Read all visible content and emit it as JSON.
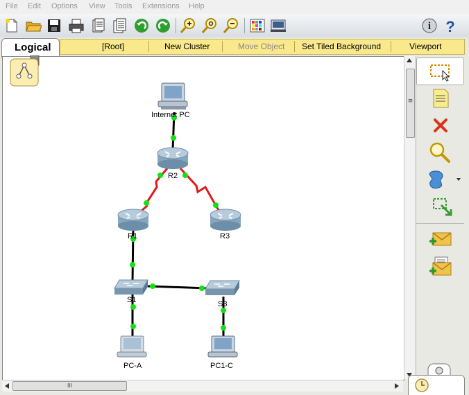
{
  "menu": [
    "File",
    "Edit",
    "Options",
    "View",
    "Tools",
    "Extensions",
    "Help"
  ],
  "toolbar": {
    "buttons": [
      "new-file-icon",
      "open-folder-icon",
      "save-icon",
      "print-icon",
      "activity-wizard-icon",
      "pdu-list-icon",
      "undo-icon",
      "redo-icon",
      "zoom-in-icon",
      "zoom-reset-icon",
      "zoom-out-icon",
      "palette-icon",
      "device-dialog-icon"
    ],
    "info_label": "i",
    "help_label": "?"
  },
  "logical_bar": {
    "tab_label": "Logical",
    "items": [
      "[Root]",
      "New Cluster",
      "Move Object",
      "Set Tiled Background",
      "Viewport"
    ],
    "disabled_item": "Move Object"
  },
  "topology": {
    "devices": [
      {
        "id": "internet-pc",
        "label": "Internet PC",
        "type": "pc"
      },
      {
        "id": "r2",
        "label": "R2",
        "type": "router"
      },
      {
        "id": "r1",
        "label": "R1",
        "type": "router"
      },
      {
        "id": "r3",
        "label": "R3",
        "type": "router"
      },
      {
        "id": "s1",
        "label": "S1",
        "type": "switch"
      },
      {
        "id": "s3",
        "label": "S3",
        "type": "switch"
      },
      {
        "id": "pc-a",
        "label": "PC-A",
        "type": "pc"
      },
      {
        "id": "pc1-c",
        "label": "PC1-C",
        "type": "pc"
      }
    ],
    "links": [
      {
        "from": "internet-pc",
        "to": "r2",
        "kind": "copper"
      },
      {
        "from": "r2",
        "to": "r1",
        "kind": "serial"
      },
      {
        "from": "r2",
        "to": "r3",
        "kind": "serial"
      },
      {
        "from": "r1",
        "to": "s1",
        "kind": "copper"
      },
      {
        "from": "s1",
        "to": "s3",
        "kind": "copper"
      },
      {
        "from": "s1",
        "to": "pc-a",
        "kind": "copper"
      },
      {
        "from": "s3",
        "to": "pc1-c",
        "kind": "copper"
      }
    ],
    "colors": {
      "copper": "#000000",
      "serial": "#e11a1a",
      "link_up": "#16e016"
    }
  },
  "right_panel": [
    "select-icon",
    "place-note-icon",
    "delete-icon",
    "inspect-icon",
    "draw-shape-icon",
    "resize-icon",
    "add-simple-pdu-icon",
    "add-complex-pdu-icon"
  ],
  "hscroll_label": "III",
  "vscroll_label": "≡"
}
